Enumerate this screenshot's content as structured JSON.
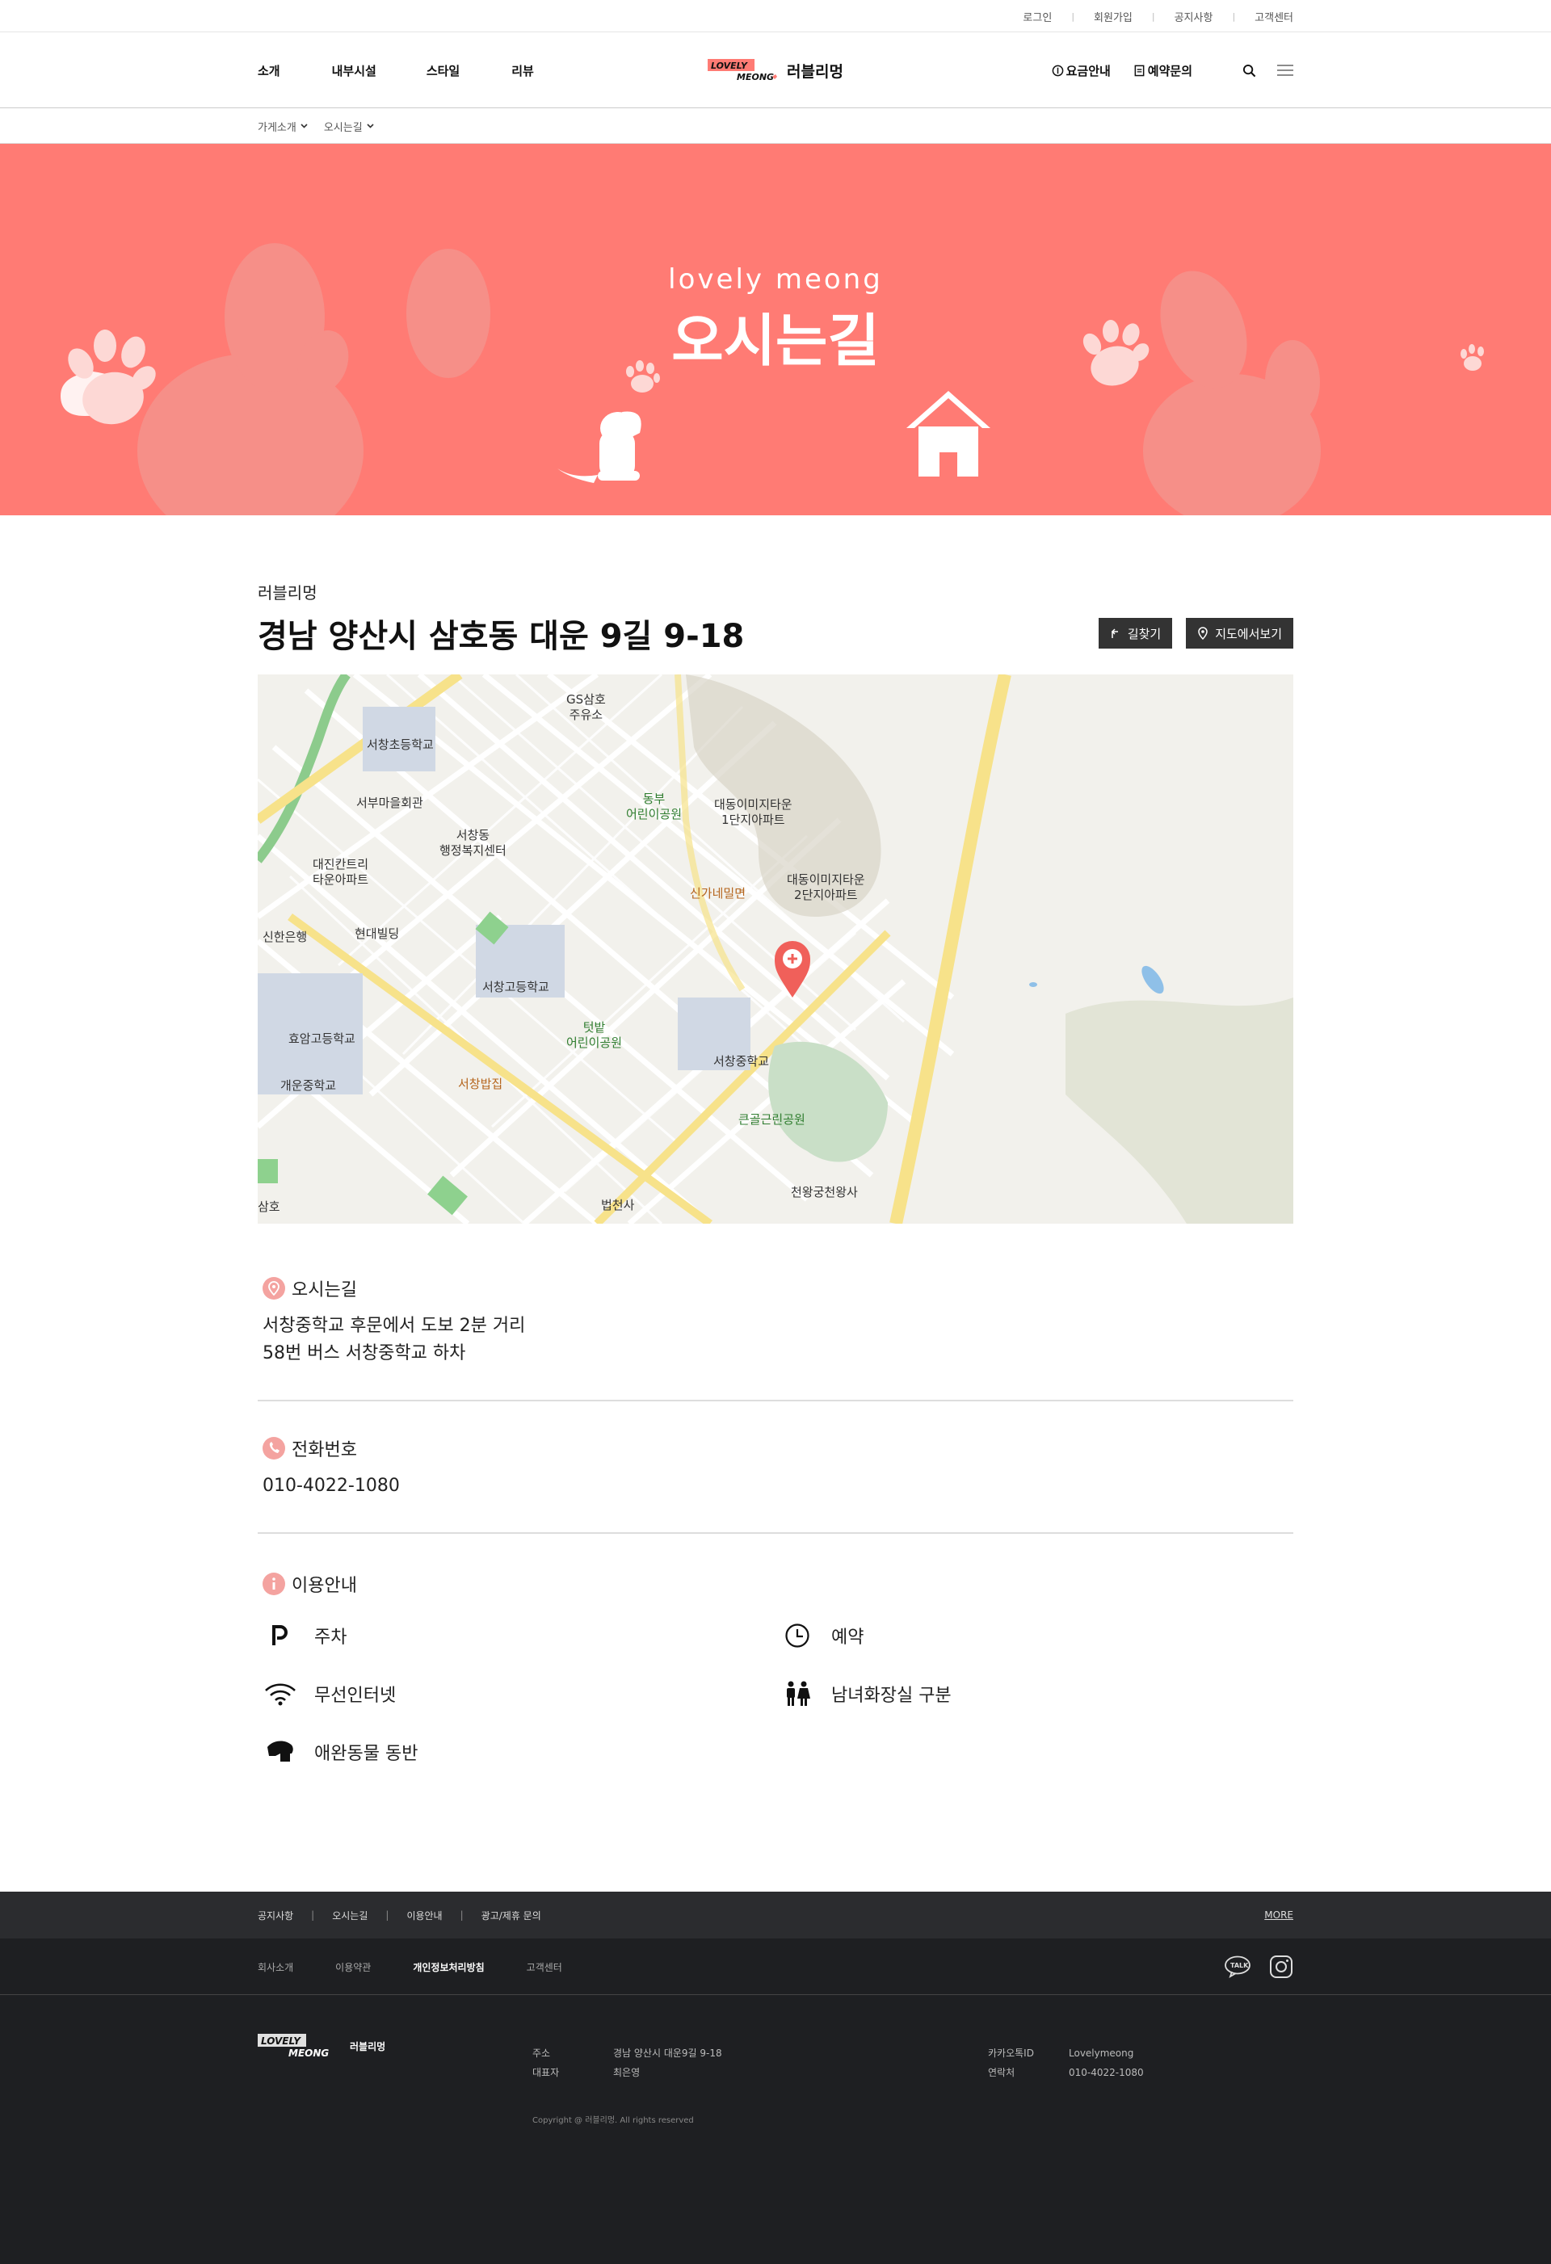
{
  "topbar": {
    "links": [
      "로그인",
      "회원가입",
      "공지사항",
      "고객센터"
    ]
  },
  "header": {
    "nav": [
      "소개",
      "내부시설",
      "스타일",
      "리뷰"
    ],
    "logo_badge_top": "LOVELY",
    "logo_badge_bottom": "MEONG",
    "logo_text": "러블리멍",
    "util": [
      "요금안내",
      "예약문의"
    ]
  },
  "breadcrumb": [
    "가게소개",
    "오시는길"
  ],
  "banner": {
    "subtitle": "lovely meong",
    "title": "오시는길"
  },
  "info": {
    "shop_name": "러블리멍",
    "address": "경남 양산시 삼호동 대운 9길 9-18",
    "btn_directions": "길찾기",
    "btn_map": "지도에서보기"
  },
  "map": {
    "labels": [
      {
        "t": "GS삼호\n주유소",
        "c": ""
      },
      {
        "t": "서창초등학교",
        "c": ""
      },
      {
        "t": "서부마을회관",
        "c": ""
      },
      {
        "t": "서창동\n행정복지센터",
        "c": ""
      },
      {
        "t": "동부\n어린이공원",
        "c": "g"
      },
      {
        "t": "대동이미지타운\n1단지아파트",
        "c": ""
      },
      {
        "t": "대진칸트리\n타운아파트",
        "c": ""
      },
      {
        "t": "신가네밀면",
        "c": "o"
      },
      {
        "t": "대동이미지타운\n2단지아파트",
        "c": ""
      },
      {
        "t": "신한은행",
        "c": ""
      },
      {
        "t": "현대빌딩",
        "c": ""
      },
      {
        "t": "서창고등학교",
        "c": ""
      },
      {
        "t": "텃밭\n어린이공원",
        "c": "g"
      },
      {
        "t": "효암고등학교",
        "c": ""
      },
      {
        "t": "서창중학교",
        "c": ""
      },
      {
        "t": "개운중학교",
        "c": ""
      },
      {
        "t": "서창밥집",
        "c": "o"
      },
      {
        "t": "큰골근린공원",
        "c": "g"
      },
      {
        "t": "천왕궁천왕사",
        "c": ""
      },
      {
        "t": "법천사",
        "c": ""
      },
      {
        "t": "삼호",
        "c": ""
      }
    ]
  },
  "directions": {
    "title": "오시는길",
    "lines": [
      "서창중학교 후문에서 도보 2분 거리",
      "58번 버스 서창중학교 하차"
    ]
  },
  "phone": {
    "title": "전화번호",
    "number": "010-4022-1080"
  },
  "guide": {
    "title": "이용안내",
    "items": [
      {
        "label": "주차",
        "icon": "parking-icon"
      },
      {
        "label": "예약",
        "icon": "clock-icon"
      },
      {
        "label": "무선인터넷",
        "icon": "wifi-icon"
      },
      {
        "label": "남녀화장실 구분",
        "icon": "restroom-icon"
      },
      {
        "label": "애완동물 동반",
        "icon": "pet-icon"
      }
    ]
  },
  "footer": {
    "links1": [
      "공지사항",
      "오시는길",
      "이용안내",
      "광고/제휴 문의"
    ],
    "more": "MORE",
    "links2": [
      "회사소개",
      "이용약관",
      "개인정보처리방침",
      "고객센터"
    ],
    "logo_text": "러블리멍",
    "address_label": "주소",
    "address": "경남 양산시 대운9길 9-18",
    "ceo_label": "대표자",
    "ceo": "최은영",
    "kakao_label": "카카오톡ID",
    "kakao": "Lovelymeong",
    "contact_label": "연락처",
    "contact": "010-4022-1080",
    "talk": "TALK",
    "copyright": "Copyright @ 러블리멍. All rights reserved"
  },
  "colors": {
    "brand": "#ff7b74",
    "dark": "#1e1f22",
    "pin": "#f0605a"
  }
}
